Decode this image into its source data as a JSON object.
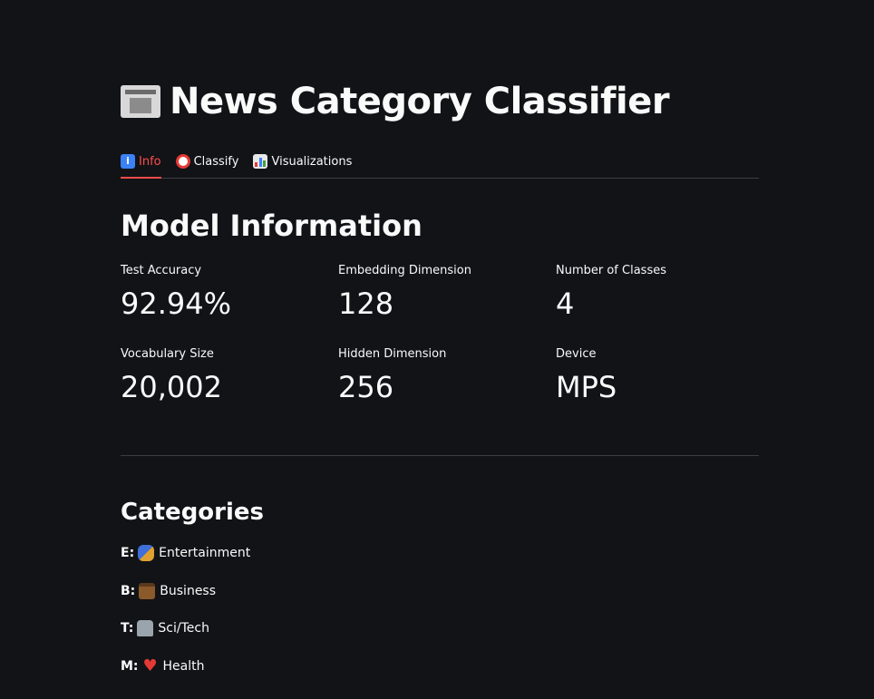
{
  "title": "News Category Classifier",
  "icons": {
    "title": "newspaper-icon",
    "tab_info": "info-icon",
    "tab_classify": "target-icon",
    "tab_visualizations": "bar-chart-icon"
  },
  "colors": {
    "background": "#111317",
    "accent": "#ff4b4b",
    "text": "#fafafa",
    "divider": "#3a3d44"
  },
  "tabs": [
    {
      "label": "Info",
      "active": true
    },
    {
      "label": "Classify",
      "active": false
    },
    {
      "label": "Visualizations",
      "active": false
    }
  ],
  "model_info": {
    "heading": "Model Information",
    "metrics": [
      {
        "label": "Test Accuracy",
        "value": "92.94%"
      },
      {
        "label": "Embedding Dimension",
        "value": "128"
      },
      {
        "label": "Number of Classes",
        "value": "4"
      },
      {
        "label": "Vocabulary Size",
        "value": "20,002"
      },
      {
        "label": "Hidden Dimension",
        "value": "256"
      },
      {
        "label": "Device",
        "value": "MPS"
      }
    ]
  },
  "categories": {
    "heading": "Categories",
    "items": [
      {
        "code": "E:",
        "icon": "performing-arts-icon",
        "label": "Entertainment"
      },
      {
        "code": "B:",
        "icon": "briefcase-icon",
        "label": "Business"
      },
      {
        "code": "T:",
        "icon": "microscope-icon",
        "label": "Sci/Tech"
      },
      {
        "code": "M:",
        "icon": "heart-icon",
        "label": "Health"
      }
    ]
  }
}
